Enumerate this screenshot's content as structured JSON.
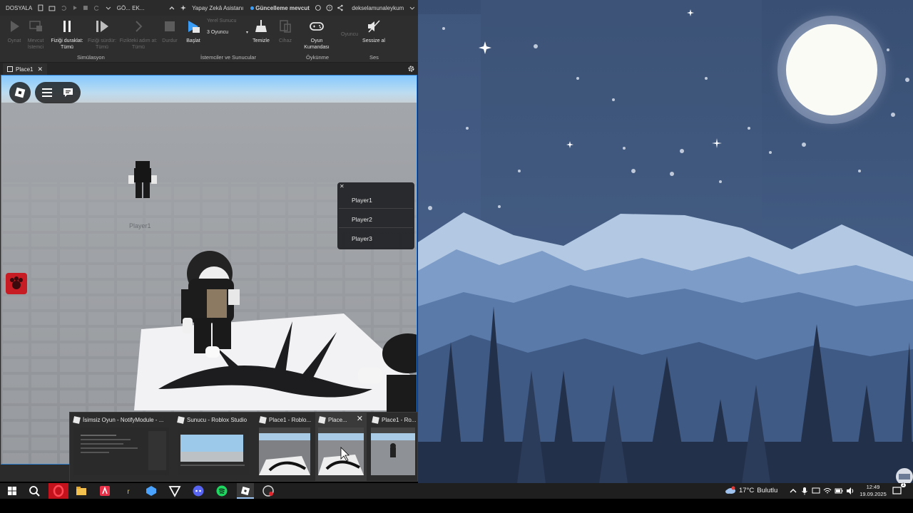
{
  "titlebar": {
    "file_menu": "DOSYALA",
    "truncated_items": "GÖ...  EK...",
    "assistant": "Yapay Zekâ Asistanı",
    "update": "Güncelleme mevcut",
    "username": "dekselamunaleykum"
  },
  "ribbon": {
    "play": "Oynat",
    "current_client": "Mevcut İstemci",
    "pause": "Fiziği duraklat: Tümü",
    "resume": "Fiziği sürdür: Tümü",
    "step": "Fizikteki adım at: Tümü",
    "stop": "Durdur",
    "start": "Başlat",
    "server_select": "Yerel Sunucu",
    "players_select": "3 Oyuncu",
    "cleanup": "Temizle",
    "device": "Cihaz",
    "controller": "Oyun Kumandası",
    "player": "Oyuncu",
    "mute": "Sessize al",
    "group_sim": "Simülasyon",
    "group_clients": "İstemciler ve Sunucular",
    "group_emulation": "Öykünme",
    "group_audio": "Ses"
  },
  "tab": {
    "label": "Place1"
  },
  "player_list": [
    "Player1",
    "Player2",
    "Player3"
  ],
  "nametag": "Player1",
  "thumbnails": [
    {
      "title": "İsimsiz Oyun - NotifyModule - ..."
    },
    {
      "title": "Sunucu - Roblox Studio"
    },
    {
      "title": "Place1 - Roblo..."
    },
    {
      "title": "Place..."
    },
    {
      "title": "Place1 - Ro..."
    }
  ],
  "tray": {
    "temperature": "17°C",
    "weather": "Bulutlu",
    "time": "12:49",
    "date": "19.09.2025",
    "notification_count": "1"
  },
  "colors": {
    "accent": "#2d7fd1",
    "sky_top": "#7fc3ff",
    "wallpaper_bg": "#3d5a80"
  }
}
